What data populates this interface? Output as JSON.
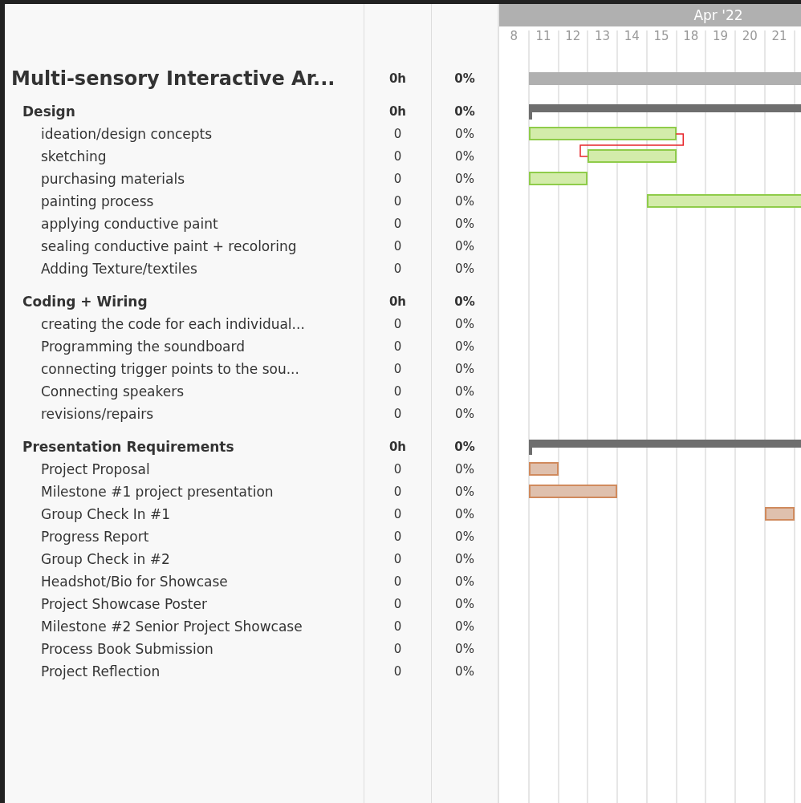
{
  "timeline": {
    "month": "Apr '22",
    "days": [
      "8",
      "11",
      "12",
      "13",
      "14",
      "15",
      "18",
      "19",
      "20",
      "21"
    ]
  },
  "project": {
    "name": "Multi-sensory Interactive Ar...",
    "hours": "0h",
    "percent": "0%",
    "bar": {
      "kind": "project"
    },
    "children": [
      {
        "name": "Design",
        "hours": "0h",
        "percent": "0%",
        "bar": {
          "kind": "summary"
        },
        "children": [
          {
            "name": "ideation/design concepts",
            "hours": "0",
            "percent": "0%",
            "bar": {
              "kind": "task",
              "color": "#d3ecaa"
            }
          },
          {
            "name": "sketching",
            "hours": "0",
            "percent": "0%",
            "bar": {
              "kind": "task",
              "color": "#d3ecaa",
              "depends_on_previous": true
            }
          },
          {
            "name": "purchasing materials",
            "hours": "0",
            "percent": "0%",
            "bar": {
              "kind": "task",
              "color": "#d3ecaa"
            }
          },
          {
            "name": "painting process",
            "hours": "0",
            "percent": "0%",
            "bar": {
              "kind": "task",
              "color": "#d3ecaa"
            }
          },
          {
            "name": "applying conductive paint",
            "hours": "0",
            "percent": "0%"
          },
          {
            "name": "sealing conductive paint + recoloring",
            "hours": "0",
            "percent": "0%"
          },
          {
            "name": "Adding Texture/textiles",
            "hours": "0",
            "percent": "0%"
          }
        ]
      },
      {
        "name": "Coding + Wiring",
        "hours": "0h",
        "percent": "0%",
        "children": [
          {
            "name": "creating the code for each individual...",
            "hours": "0",
            "percent": "0%"
          },
          {
            "name": "Programming the soundboard",
            "hours": "0",
            "percent": "0%"
          },
          {
            "name": "connecting trigger points to the sou...",
            "hours": "0",
            "percent": "0%"
          },
          {
            "name": "Connecting speakers",
            "hours": "0",
            "percent": "0%"
          },
          {
            "name": "revisions/repairs",
            "hours": "0",
            "percent": "0%"
          }
        ]
      },
      {
        "name": "Presentation Requirements",
        "hours": "0h",
        "percent": "0%",
        "bar": {
          "kind": "summary"
        },
        "children": [
          {
            "name": "Project Proposal",
            "hours": "0",
            "percent": "0%",
            "bar": {
              "kind": "task",
              "color": "#dfc0ad"
            }
          },
          {
            "name": "Milestone #1 project presentation",
            "hours": "0",
            "percent": "0%",
            "bar": {
              "kind": "task",
              "color": "#dfc0ad"
            }
          },
          {
            "name": "Group Check In #1",
            "hours": "0",
            "percent": "0%",
            "bar": {
              "kind": "task",
              "color": "#dfc0ad"
            }
          },
          {
            "name": "Progress Report",
            "hours": "0",
            "percent": "0%"
          },
          {
            "name": "Group Check in #2",
            "hours": "0",
            "percent": "0%"
          },
          {
            "name": "Headshot/Bio for Showcase",
            "hours": "0",
            "percent": "0%"
          },
          {
            "name": "Project Showcase Poster",
            "hours": "0",
            "percent": "0%"
          },
          {
            "name": "Milestone #2 Senior Project Showcase",
            "hours": "0",
            "percent": "0%"
          },
          {
            "name": "Process Book Submission",
            "hours": "0",
            "percent": "0%"
          },
          {
            "name": "Project Reflection",
            "hours": "0",
            "percent": "0%"
          }
        ]
      }
    ]
  }
}
